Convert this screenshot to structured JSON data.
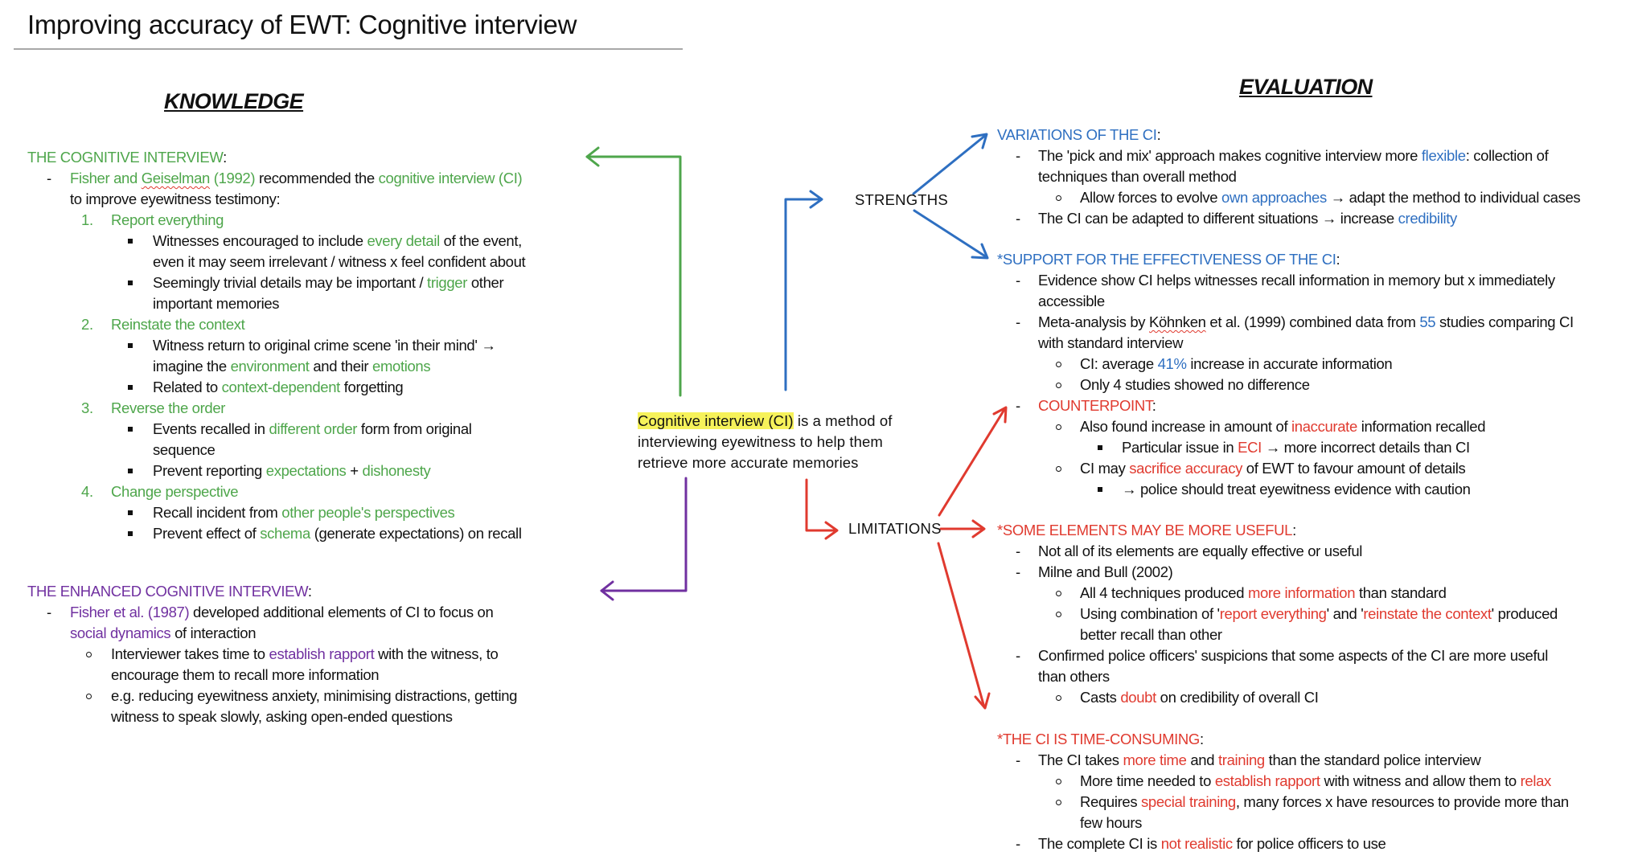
{
  "title": "Improving accuracy of EWT: Cognitive interview",
  "colors": {
    "knowledge": "#4ea64b",
    "enhanced": "#7030a0",
    "strengths": "#2e6fc1",
    "limitations": "#e03a2f",
    "highlight": "#f6f25a"
  },
  "knowledge": {
    "heading": "KNOWLEDGE",
    "ci": {
      "header": "THE COGNITIVE INTERVIEW",
      "colon": ":",
      "intro": {
        "cite_a": "Fisher and ",
        "cite_b": "Geiselman",
        "cite_c": " (1992)",
        "text_a": " recommended the ",
        "term": "cognitive interview (CI)",
        "text_b": "to improve eyewitness testimony:"
      },
      "techniques": [
        {
          "num": "1.",
          "name": "Report everything"
        },
        {
          "num": "2.",
          "name": "Reinstate the context"
        },
        {
          "num": "3.",
          "name": "Reverse the order"
        },
        {
          "num": "4.",
          "name": "Change perspective"
        }
      ],
      "t1": {
        "b1_a": "Witnesses encouraged to include ",
        "b1_k": "every detail",
        "b1_b": " of the event,",
        "b1_c": "even it may seem irrelevant / witness x feel confident about",
        "b2_a": "Seemingly trivial details may be important / ",
        "b2_k": "trigger",
        "b2_b": " other",
        "b2_c": "important memories"
      },
      "t2": {
        "b1_a": "Witness return to original crime scene 'in their mind' →",
        "b1_b": "imagine the ",
        "b1_k1": "environment",
        "b1_c": " and their ",
        "b1_k2": "emotions",
        "b2_a": "Related to ",
        "b2_k": "context-dependent",
        "b2_b": " forgetting"
      },
      "t3": {
        "b1_a": "Events recalled in ",
        "b1_k": "different order",
        "b1_b": " form from original",
        "b1_c": "sequence",
        "b2_a": "Prevent reporting ",
        "b2_k1": "expectations",
        "b2_b": " + ",
        "b2_k2": "dishonesty"
      },
      "t4": {
        "b1_a": "Recall incident from ",
        "b1_k": "other people's perspectives",
        "b2_a": "Prevent effect of ",
        "b2_k": "schema",
        "b2_b": " (generate expectations) on recall"
      }
    },
    "eci": {
      "header": "THE ENHANCED COGNITIVE INTERVIEW",
      "colon": ":",
      "cite": "Fisher et al. (1987)",
      "text_a": " developed additional elements of CI to focus on",
      "term": "social dynamics",
      "text_b": " of interaction",
      "s1_a": "Interviewer takes time to ",
      "s1_k": "establish rapport",
      "s1_b": " with the witness, to",
      "s1_c": "encourage them to recall more information",
      "s2_a": "e.g. reducing eyewitness anxiety, minimising distractions, getting",
      "s2_b": "witness to speak slowly, asking open-ended questions"
    }
  },
  "center": {
    "highlight": "Cognitive interview (CI)",
    "line1_rest": " is a method of",
    "line2": "interviewing eyewitness to help them",
    "line3": "retrieve more accurate memories"
  },
  "nodes": {
    "strengths": "STRENGTHS",
    "limitations": "LIMITATIONS"
  },
  "evaluation": {
    "heading": "EVALUATION",
    "variations": {
      "header": "VARIATIONS OF THE CI",
      "colon": ":",
      "p1_a": "The 'pick and mix' approach makes cognitive interview more ",
      "p1_k": "flexible",
      "p1_b": ": collection of",
      "p1_c": "techniques than overall method",
      "p1_s_a": "Allow forces to evolve ",
      "p1_s_k": "own approaches",
      "p1_s_b": " → adapt the method to individual cases",
      "p2_a": "The CI can be adapted to different situations → increase ",
      "p2_k": "credibility"
    },
    "support": {
      "header": "*SUPPORT FOR THE EFFECTIVENESS OF THE CI",
      "colon": ":",
      "p1_a": "Evidence show CI helps witnesses recall information in memory but x immediately",
      "p1_b": "accessible",
      "p2_a": "Meta-analysis by ",
      "p2_name": "Köhnken",
      "p2_b": " et al. (1999) combined data from ",
      "p2_k": "55",
      "p2_c": " studies comparing CI",
      "p2_d": "with standard interview",
      "s1_a": "CI: average ",
      "s1_k": "41%",
      "s1_b": " increase in accurate information",
      "s2": "Only 4 studies showed no difference",
      "counter": "COUNTERPOINT",
      "counter_colon": ":",
      "c1_a": "Also found increase in amount of ",
      "c1_k": "inaccurate",
      "c1_b": " information recalled",
      "c1_s_a": "Particular issue in ",
      "c1_s_k": "ECI",
      "c1_s_b": " → more incorrect details than CI",
      "c2_a": "CI may ",
      "c2_k": "sacrifice accuracy",
      "c2_b": " of EWT to favour amount of details",
      "c2_s": "→ police should treat eyewitness evidence with caution"
    },
    "elements": {
      "header": "*SOME ELEMENTS MAY BE MORE USEFUL",
      "colon": ":",
      "p1": "Not all of its elements are equally effective or useful",
      "p2": "Milne and Bull (2002)",
      "s1_a": "All 4 techniques produced ",
      "s1_k": "more information",
      "s1_b": " than standard",
      "s2_a": "Using combination of '",
      "s2_k1": "report everything",
      "s2_b": "' and '",
      "s2_k2": "reinstate the context",
      "s2_c": "' produced",
      "s2_d": "better recall than other",
      "p3_a": "Confirmed police officers' suspicions that some aspects of the CI are more useful",
      "p3_b": "than others",
      "s3_a": "Casts ",
      "s3_k": "doubt",
      "s3_b": " on credibility of overall CI"
    },
    "time": {
      "header": "*THE CI IS TIME-CONSUMING",
      "colon": ":",
      "p1_a": "The CI takes ",
      "p1_k1": "more time",
      "p1_b": " and ",
      "p1_k2": "training",
      "p1_c": " than the standard police interview",
      "s1_a": "More time needed to ",
      "s1_k1": "establish rapport",
      "s1_b": " with witness and allow them to ",
      "s1_k2": "relax",
      "s2_a": "Requires ",
      "s2_k": "special training",
      "s2_b": ", many forces x have resources to provide more than",
      "s2_c": "few hours",
      "p2_a": "The complete CI is ",
      "p2_k": "not realistic",
      "p2_b": " for police officers to use"
    }
  },
  "markers": {
    "dash": "-",
    "square": "▪",
    "circle": "o"
  }
}
